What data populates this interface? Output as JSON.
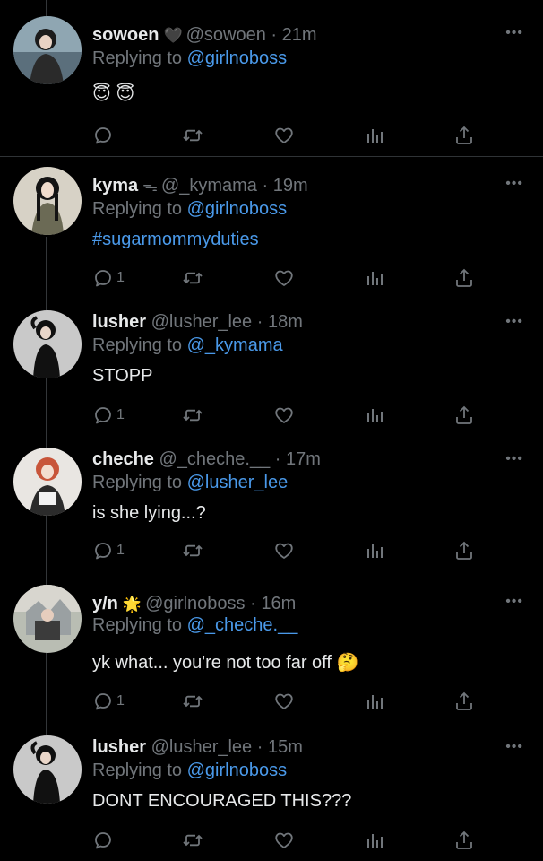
{
  "tweets": [
    {
      "name": "sowoen",
      "badge": "🖤",
      "handle": "@sowoen",
      "time": "21m",
      "replying_prefix": "Replying to ",
      "replying_to": "@girlnoboss",
      "text": "😇 😇",
      "reply_count": "",
      "more": "•••"
    },
    {
      "name": "kyma",
      "badge": "ᯓ",
      "handle": "@_kymama",
      "time": "19m",
      "replying_prefix": "Replying to ",
      "replying_to": "@girlnoboss",
      "text": "#sugarmommyduties",
      "reply_count": "1",
      "more": "•••"
    },
    {
      "name": "lusher",
      "badge": "",
      "handle": "@lusher_lee",
      "time": "18m",
      "replying_prefix": "Replying to ",
      "replying_to": "@_kymama",
      "text": "STOPP",
      "reply_count": "1",
      "more": "•••"
    },
    {
      "name": "cheche",
      "badge": "",
      "handle": "@_cheche.__",
      "time": "17m",
      "replying_prefix": "Replying to ",
      "replying_to": "@lusher_lee",
      "text": "is she lying...?",
      "reply_count": "1",
      "more": "•••"
    },
    {
      "name": "y/n",
      "badge": "🌟",
      "handle": "@girlnoboss",
      "time": "16m",
      "replying_prefix": "Replying to ",
      "replying_to": "@_cheche.__",
      "text": "yk what... you're not too far off 🤔",
      "reply_count": "1",
      "more": "•••"
    },
    {
      "name": "lusher",
      "badge": "",
      "handle": "@lusher_lee",
      "time": "15m",
      "replying_prefix": "Replying to ",
      "replying_to": "@girlnoboss",
      "text": "DONT ENCOURAGED THIS???",
      "reply_count": "",
      "more": "•••"
    }
  ],
  "separator": " · ",
  "icons": [
    "reply-icon",
    "retweet-icon",
    "like-icon",
    "views-icon",
    "share-icon",
    "more-icon"
  ],
  "colors": {
    "background": "#000000",
    "text": "#e7e9ea",
    "muted": "#71767b",
    "link": "#4a99e9",
    "divider": "#2f3336"
  }
}
